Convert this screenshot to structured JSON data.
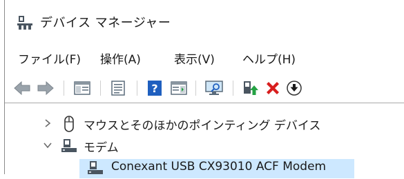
{
  "window": {
    "title": "デバイス マネージャー",
    "title_icon": "device-manager-icon"
  },
  "menubar": {
    "items": [
      {
        "id": "file",
        "label": "ファイル(F)"
      },
      {
        "id": "operation",
        "label": "操作(A)"
      },
      {
        "id": "view",
        "label": "表示(V)"
      },
      {
        "id": "help",
        "label": "ヘルプ(H)"
      }
    ]
  },
  "toolbar": {
    "buttons": [
      {
        "icon": "back-arrow-icon",
        "enabled": true
      },
      {
        "icon": "forward-arrow-icon",
        "enabled": true
      },
      {
        "icon": "show-hide-console-tree-icon",
        "enabled": true
      },
      {
        "icon": "properties-icon",
        "enabled": true
      },
      {
        "icon": "help-icon",
        "enabled": true
      },
      {
        "icon": "action-pane-icon",
        "enabled": true
      },
      {
        "icon": "scan-hardware-changes-icon",
        "enabled": true
      },
      {
        "icon": "update-driver-icon",
        "enabled": true
      },
      {
        "icon": "uninstall-device-icon",
        "enabled": true
      },
      {
        "icon": "disable-device-icon",
        "enabled": true
      }
    ],
    "colors": {
      "blue": "#1f5fbf",
      "red": "#d81e1e",
      "green": "#25a244",
      "gray": "#5a6b7a"
    }
  },
  "tree": {
    "nodes": [
      {
        "label": "マウスとそのほかのポインティング デバイス",
        "expanded": false,
        "icon": "mouse-icon"
      },
      {
        "label": "モデム",
        "expanded": true,
        "icon": "modem-icon"
      },
      {
        "label": "Conexant USB CX93010 ACF Modem",
        "selected": true,
        "icon": "modem-device-icon"
      }
    ],
    "selection_color": "#cde8ff"
  }
}
